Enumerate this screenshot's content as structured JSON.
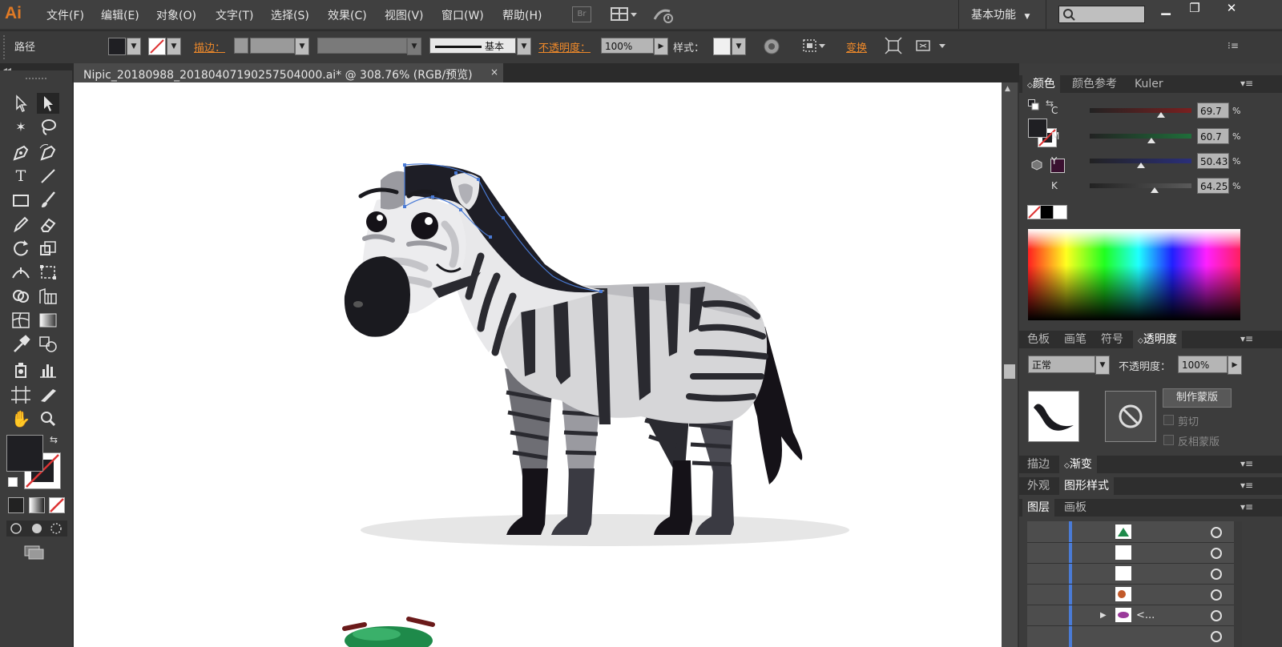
{
  "app": {
    "logo": "Ai",
    "menu": [
      "文件(F)",
      "编辑(E)",
      "对象(O)",
      "文字(T)",
      "选择(S)",
      "效果(C)",
      "视图(V)",
      "窗口(W)",
      "帮助(H)"
    ],
    "bridge_label": "Br",
    "workspace": "基本功能",
    "window_buttons": [
      "minimize-icon",
      "restore-icon",
      "close-icon"
    ]
  },
  "control_bar": {
    "selection_label": "路径",
    "stroke_label": "描边：",
    "stroke_profile": "基本",
    "opacity_label": "不透明度：",
    "opacity_value": "100%",
    "style_label": "样式：",
    "transform_label": "变换"
  },
  "document": {
    "tab_title": "Nipic_20180988_20180407190257504000.ai* @ 308.76% (RGB/预览)",
    "tab_close": "×"
  },
  "color_panel": {
    "tabs": [
      "颜色",
      "颜色参考",
      "Kuler"
    ],
    "active_tab": "颜色",
    "channels": [
      {
        "label": "C",
        "value": "69.7",
        "level": 0.7,
        "track": "#7a2020"
      },
      {
        "label": "M",
        "value": "60.7",
        "level": 0.61,
        "track": "#1f6e3a"
      },
      {
        "label": "Y",
        "value": "50.43",
        "level": 0.5,
        "track": "#2a2f7a"
      },
      {
        "label": "K",
        "value": "64.25",
        "level": 0.64,
        "track": "#5a5a5a"
      }
    ],
    "percent": "%",
    "fill_color": "#1f1f23",
    "out_of_gamut_color": "#3a1030"
  },
  "transparency_panel": {
    "tabs": [
      "色板",
      "画笔",
      "符号",
      "透明度"
    ],
    "active_tab": "透明度",
    "blend_mode": "正常",
    "opacity_label": "不透明度：",
    "opacity_value": "100%",
    "make_mask": "制作蒙版",
    "clip": "剪切",
    "invert_mask": "反相蒙版"
  },
  "stroke_gradient_tabs": [
    "描边",
    "渐变"
  ],
  "appearance_tabs": [
    "外观",
    "图形样式"
  ],
  "layers_panel": {
    "tabs": [
      "图层",
      "画板"
    ],
    "active_tab": "图层",
    "visible_text": [
      "<..."
    ]
  },
  "colors": {
    "accent_orange": "#f08a2a",
    "panel_bg": "#3c3c3c",
    "selection_blue": "#4a7bd6"
  }
}
